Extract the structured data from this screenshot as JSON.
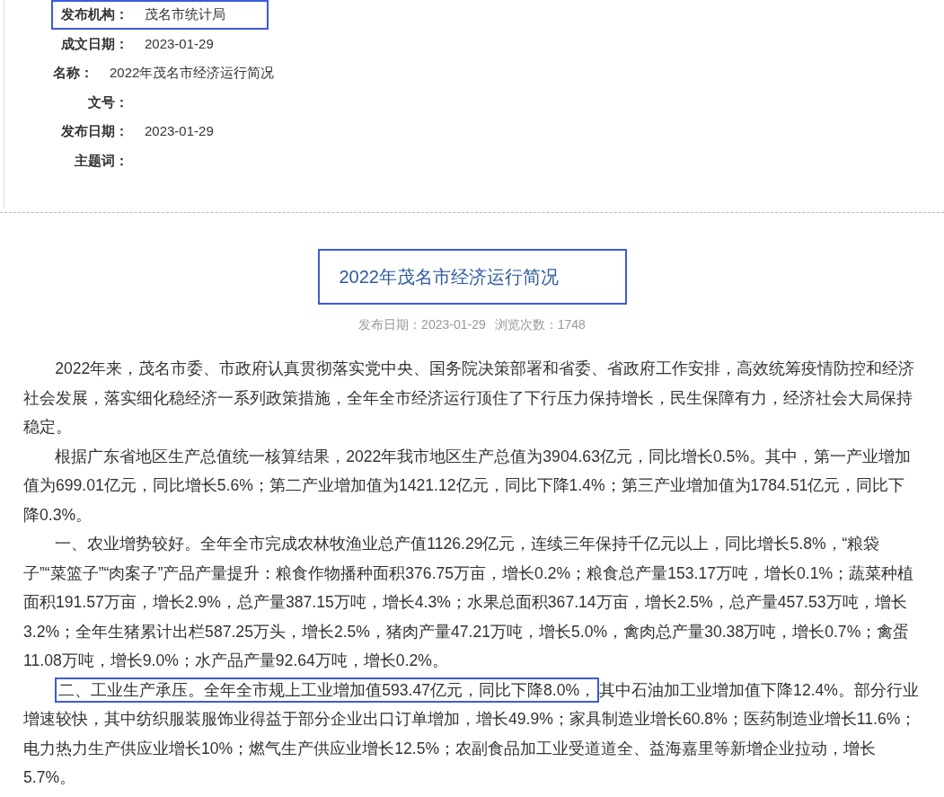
{
  "meta": [
    {
      "label": "发布机构：",
      "value": "茂名市统计局",
      "highlighted": true
    },
    {
      "label": "成文日期：",
      "value": "2023-01-29",
      "highlighted": false
    },
    {
      "label": "名称：",
      "value": "2022年茂名市经济运行简况",
      "highlighted": false
    },
    {
      "label": "文号：",
      "highlighted": false
    },
    {
      "label": "发布日期：",
      "value": "2023-01-29",
      "highlighted": false
    },
    {
      "label": "主题词：",
      "highlighted": false
    }
  ],
  "article": {
    "title": "2022年茂名市经济运行简况",
    "title_highlighted": true,
    "info": [
      "发布日期：2023-01-29",
      "浏览次数：1748"
    ],
    "paragraphs": [
      {
        "text": "2022年来，茂名市委、市政府认真贯彻落实党中央、国务院决策部署和省委、省政府工作安排，高效统筹疫情防控和经济社会发展，落实细化稳经济一系列政策措施，全年全市经济运行顶住了下行压力保持增长，民生保障有力，经济社会大局保持稳定。"
      },
      {
        "text": "根据广东省地区生产总值统一核算结果，2022年我市地区生产总值为3904.63亿元，同比增长0.5%。其中，第一产业增加值为699.01亿元，同比增长5.6%；第二产业增加值为1421.12亿元，同比下降1.4%；第三产业增加值为1784.51亿元，同比下降0.3%。"
      },
      {
        "text": "一、农业增势较好。全年全市完成农林牧渔业总产值1126.29亿元，连续三年保持千亿元以上，同比增长5.8%，“粮袋子”“菜篮子”“肉案子”产品产量提升：粮食作物播种面积376.75万亩，增长0.2%；粮食总产量153.17万吨，增长0.1%；蔬菜种植面积191.57万亩，增长2.9%，总产量387.15万吨，增长4.3%；水果总面积367.14万亩，增长2.5%，总产量457.53万吨，增长3.2%；全年生猪累计出栏587.25万头，增长2.5%，猪肉产量47.21万吨，增长5.0%，禽肉总产量30.38万吨，增长0.7%；禽蛋11.08万吨，增长9.0%；水产品产量92.64万吨，增长0.2%。"
      },
      {
        "highlight": "二、工业生产承压。全年全市规上工业增加值593.47亿元，同比下降8.0%，",
        "text": "其中石油加工业增加值下降12.4%。部分行业增速较快，其中纺织服装服饰业得益于部分企业出口订单增加，增长49.9%；家具制造业增长60.8%；医药制造业增长11.6%；电力热力生产供应业增长10%；燃气生产供应业增长12.5%；农副食品加工业受道道全、益海嘉里等新增企业拉动，增长5.7%。"
      }
    ]
  }
}
